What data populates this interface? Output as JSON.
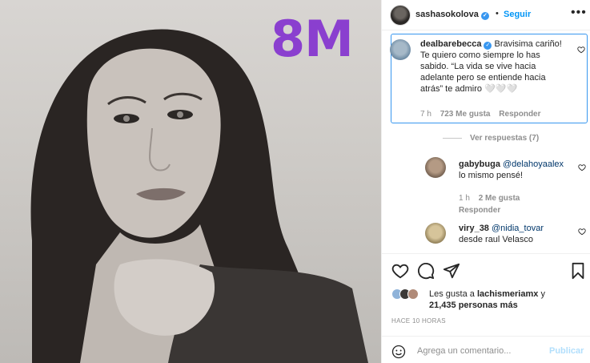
{
  "photo": {
    "caption": "8M",
    "caption_color": "#8a3fcf"
  },
  "header": {
    "username": "sashasokolova",
    "separator": "•",
    "follow_label": "Seguir",
    "more_icon": "more-horizontal-icon"
  },
  "comments": [
    {
      "user": "dealbarebecca",
      "verified": true,
      "text": "Bravisima cariño! Te quiero como siempre lo has sabido. “La vida se vive hacia adelante pero se entiende hacia atrás” te admiro 🤍🤍🤍",
      "time": "7 h",
      "likes": "723 Me gusta",
      "reply": "Responder",
      "highlighted": true
    }
  ],
  "view_replies": "Ver respuestas (7)",
  "replies": [
    {
      "user": "gabybuga",
      "mention": "@delahoyaalex",
      "text": "lo mismo pensé!",
      "time": "1 h",
      "likes": "2 Me gusta",
      "reply": "Responder"
    },
    {
      "user": "viry_38",
      "mention": "@nidia_tovar",
      "text": "desde raul Velasco"
    }
  ],
  "likes": {
    "prefix": "Les gusta a",
    "user": "lachismeriamx",
    "connector": "y",
    "count": "21,435 personas más"
  },
  "time_ago": "HACE 10 HORAS",
  "composer": {
    "placeholder": "Agrega un comentario...",
    "publish_label": "Publicar"
  },
  "colors": {
    "link": "#0095f6",
    "highlight_border": "#3897f0",
    "muted": "#8e8e8e"
  }
}
